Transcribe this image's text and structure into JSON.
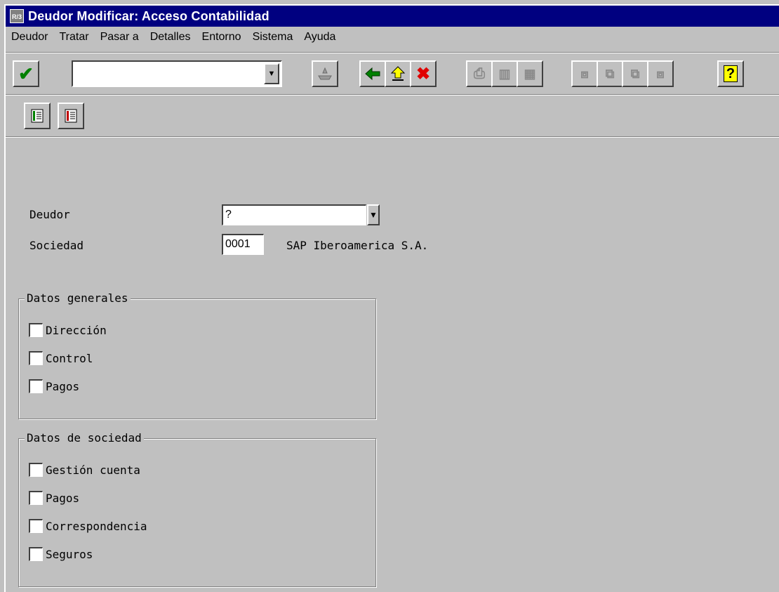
{
  "window": {
    "app_icon_text": "R/3",
    "title": "Deudor Modificar: Acceso Contabilidad"
  },
  "menu": [
    "Deudor",
    "Tratar",
    "Pasar a",
    "Detalles",
    "Entorno",
    "Sistema",
    "Ayuda"
  ],
  "toolbar": {
    "command_field_value": "",
    "icons": {
      "enter": "check-icon",
      "save": "save-icon",
      "back": "back-arrow-icon",
      "exit": "up-arrow-icon",
      "cancel": "cancel-icon",
      "print": "print-icon",
      "find": "find-icon",
      "find_next": "find-next-icon",
      "first_page": "first-page-icon",
      "prev_page": "prev-page-icon",
      "next_page": "next-page-icon",
      "last_page": "last-page-icon",
      "help": "help-icon"
    },
    "help_label": "?"
  },
  "app_toolbar": {
    "icons": [
      "select-all-icon",
      "deselect-all-icon"
    ]
  },
  "form": {
    "deudor_label": "Deudor",
    "deudor_value": "?",
    "sociedad_label": "Sociedad",
    "sociedad_value": "0001",
    "sociedad_text": "SAP Iberoamerica S.A."
  },
  "datos_generales": {
    "title": "Datos generales",
    "items": [
      "Dirección",
      "Control",
      "Pagos"
    ]
  },
  "datos_sociedad": {
    "title": "Datos de sociedad",
    "items": [
      "Gestión cuenta",
      "Pagos",
      "Correspondencia",
      "Seguros"
    ]
  },
  "colors": {
    "title_bar": "#000080",
    "window_bg": "#c0c0c0",
    "check_green": "#008000",
    "cancel_red": "#e00000",
    "help_yellow": "#ffff00"
  }
}
